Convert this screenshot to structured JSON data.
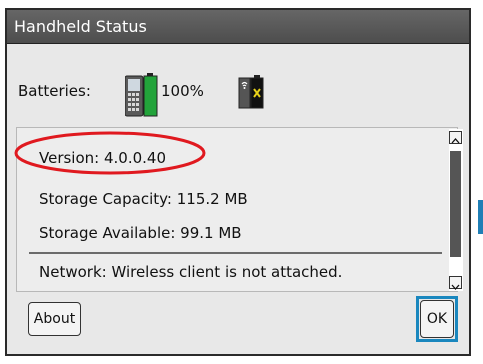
{
  "dialog": {
    "title": "Handheld Status",
    "batteries": {
      "label": "Batteries:",
      "percent": "100%",
      "icons": [
        "handheld-battery-icon",
        "wireless-adapter-battery-icon"
      ]
    },
    "info_rows": [
      {
        "label": "Version: 4.0.0.40",
        "highlighted": true
      },
      {
        "label": "Storage Capacity: 115.2 MB"
      },
      {
        "label": "Storage Available: 99.1 MB"
      },
      {
        "label": "Network: Wireless client is not attached."
      }
    ],
    "buttons": {
      "about": "About",
      "ok": "OK"
    }
  },
  "colors": {
    "title_bar": "#555555",
    "dialog_bg": "#e8e8e8",
    "battery_green": "#22a33a",
    "highlight_ellipse": "#e0191f",
    "focus_ring": "#1a87be"
  }
}
